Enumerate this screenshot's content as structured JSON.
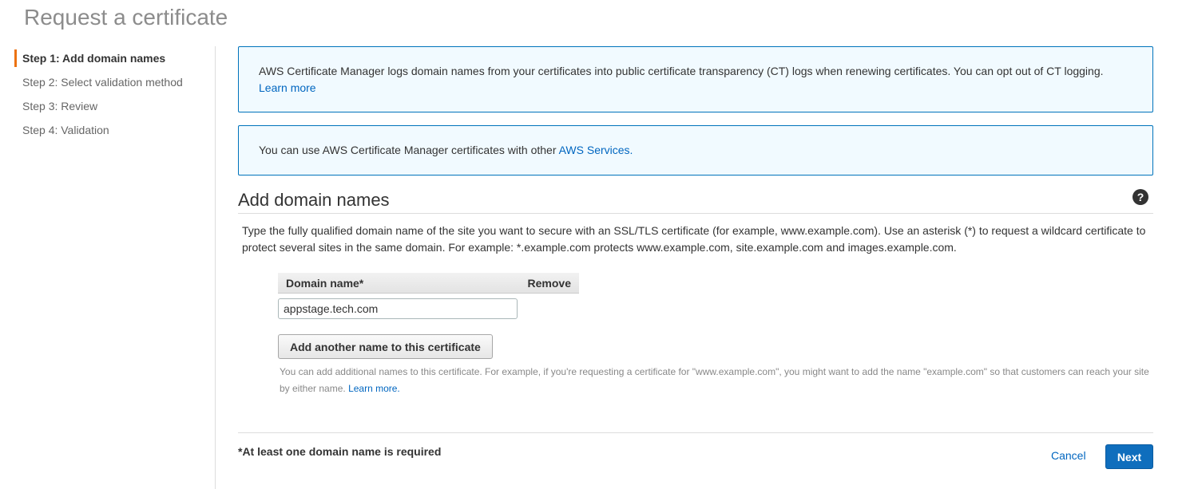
{
  "page": {
    "title": "Request a certificate"
  },
  "steps": [
    {
      "label": "Step 1: Add domain names",
      "active": true
    },
    {
      "label": "Step 2: Select validation method",
      "active": false
    },
    {
      "label": "Step 3: Review",
      "active": false
    },
    {
      "label": "Step 4: Validation",
      "active": false
    }
  ],
  "info": {
    "ct_text": "AWS Certificate Manager logs domain names from your certificates into public certificate transparency (CT) logs when renewing certificates. You can opt out of CT logging.",
    "ct_link": "Learn more",
    "services_text": "You can use AWS Certificate Manager certificates with other",
    "services_link": "AWS Services."
  },
  "section": {
    "title": "Add domain names",
    "help_icon": "question-mark-icon",
    "description": "Type the fully qualified domain name of the site you want to secure with an SSL/TLS certificate (for example, www.example.com). Use an asterisk (*) to request a wildcard certificate to protect several sites in the same domain. For example: *.example.com protects www.example.com, site.example.com and images.example.com."
  },
  "table": {
    "col_domain": "Domain name*",
    "col_remove": "Remove",
    "domain_value": "appstage.tech.com"
  },
  "add_button": "Add another name to this certificate",
  "hint": {
    "text": "You can add additional names to this certificate. For example, if you're requesting a certificate for \"www.example.com\", you might want to add the name \"example.com\" so that customers can reach your site by either name.",
    "link": "Learn more."
  },
  "footer": {
    "required_note": "*At least one domain name is required",
    "cancel": "Cancel",
    "next": "Next"
  },
  "colors": {
    "accent": "#ec7211",
    "primary": "#0f6ebd",
    "link": "#0066c0",
    "info_border": "#0073bb",
    "info_bg": "#f1faff"
  }
}
